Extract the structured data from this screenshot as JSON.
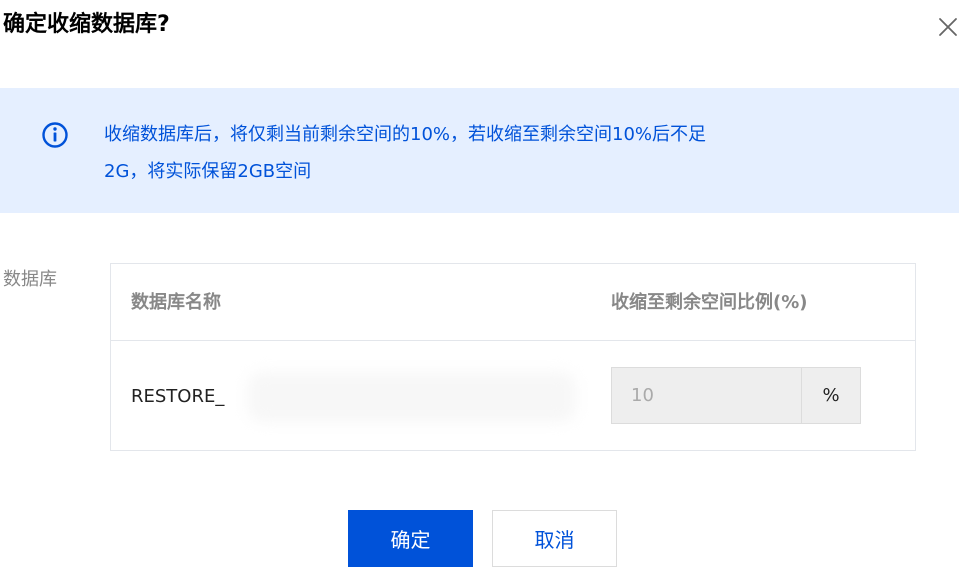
{
  "dialog": {
    "title": "确定收缩数据库?",
    "close_icon": "close-icon"
  },
  "alert": {
    "icon": "info-icon",
    "lines": [
      "收缩数据库后，将仅剩当前剩余空间的10%，若收缩至剩余空间10%后不足",
      "2G，将实际保留2GB空间"
    ]
  },
  "form": {
    "field_label": "数据库",
    "table": {
      "columns": [
        "数据库名称",
        "收缩至剩余空间比例(%)"
      ],
      "rows": [
        {
          "name": "RESTORE_",
          "ratio_value": "10",
          "ratio_suffix": "%"
        }
      ]
    }
  },
  "footer": {
    "confirm_label": "确定",
    "cancel_label": "取消"
  },
  "colors": {
    "primary": "#0052d9",
    "alert_bg": "#e5efff",
    "muted_text": "#888888",
    "border": "#e3e6eb"
  }
}
